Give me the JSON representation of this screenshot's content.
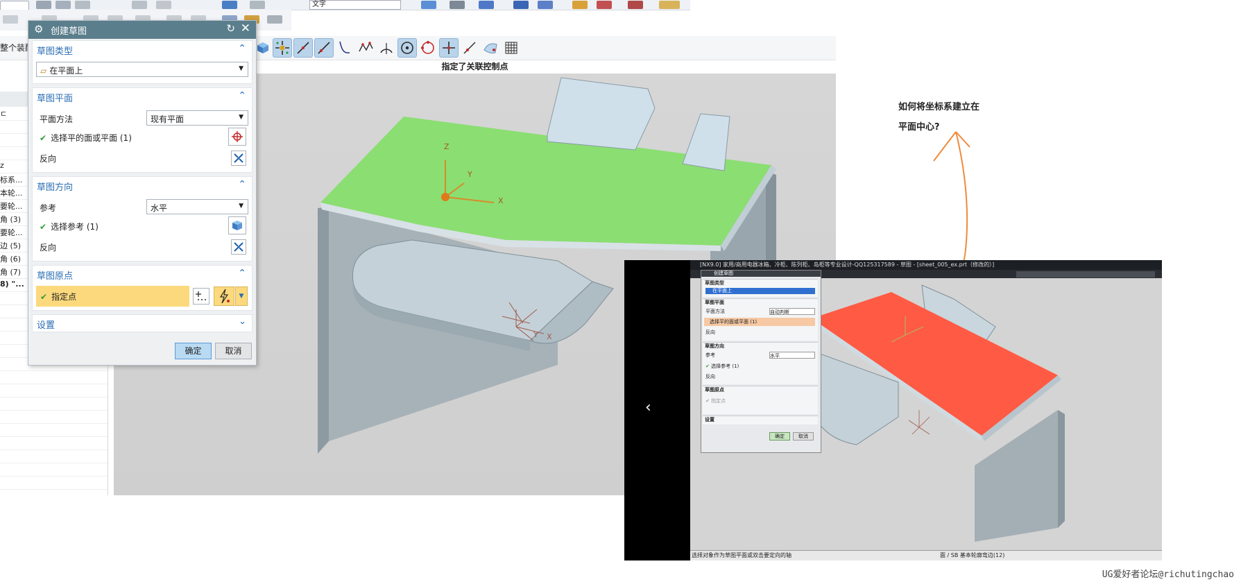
{
  "toolbar": {
    "text_dropdown": "文字",
    "full_assembly": "整个装配"
  },
  "viewport": {
    "message": "指定了关联控制点"
  },
  "navigator": {
    "items": [
      "ㄷ",
      "z",
      "标系...",
      "本轮...",
      "要轮...",
      "角 (3)",
      "要轮...",
      "边 (5)",
      "角 (6)",
      "角 (7)",
      "8) \"..."
    ]
  },
  "dialog": {
    "title": "创建草图",
    "sketch_type": {
      "header": "草图类型",
      "value": "在平面上"
    },
    "sketch_plane": {
      "header": "草图平面",
      "plane_method_label": "平面方法",
      "plane_method_value": "现有平面",
      "select_label": "选择平的面或平面 (1)",
      "reverse_label": "反向"
    },
    "sketch_orientation": {
      "header": "草图方向",
      "reference_label": "参考",
      "reference_value": "水平",
      "select_label": "选择参考 (1)",
      "reverse_label": "反向"
    },
    "sketch_origin": {
      "header": "草图原点",
      "point_label": "指定点"
    },
    "settings": {
      "header": "设置"
    },
    "ok_label": "确定",
    "cancel_label": "取消"
  },
  "annotation": {
    "line1": "如何将坐标系建立在",
    "line2": "平面中心?"
  },
  "axes": {
    "x": "X",
    "y": "Y",
    "z": "Z"
  },
  "inset": {
    "title": "[NX9.0] 家用/商用电器冰箱、冷柜、陈列柜、岛柜等专业设计-QQ125317589 - 草图 - [sheet_005_ex.prt（修改的）]",
    "status_left": "选择对象作为草图平面或双击要定向的轴",
    "status_right": "面 / SB 基本轮廓弯边(12)",
    "prev_arrow": "‹",
    "dialog": {
      "title": "创建草图",
      "sketch_type": "草图类型",
      "type_value": "在平面上",
      "sketch_plane": "草图平面",
      "plane_method": "平面方法",
      "plane_method_value": "自动判断",
      "select_face": "选择平的面或平面 (1)",
      "reverse": "反向",
      "sketch_orientation": "草图方向",
      "reference": "参考",
      "reference_value": "水平",
      "select_ref": "选择参考 (1)",
      "reverse2": "反向",
      "sketch_origin": "草图原点",
      "point": "指定点",
      "settings": "设置",
      "ok": "确定",
      "cancel": "取消"
    }
  },
  "watermark": "UG爱好者论坛@richutingchao",
  "colors": {
    "face_selected_main": "#8bde72",
    "face_selected_inset": "#ff5a44",
    "sheet_metal": "#c9d6de",
    "dialog_title": "#5a7e8c",
    "accent_blue": "#2a6db3",
    "origin_highlight": "#fcd97c",
    "annotation_arrow": "#f08a3c"
  }
}
